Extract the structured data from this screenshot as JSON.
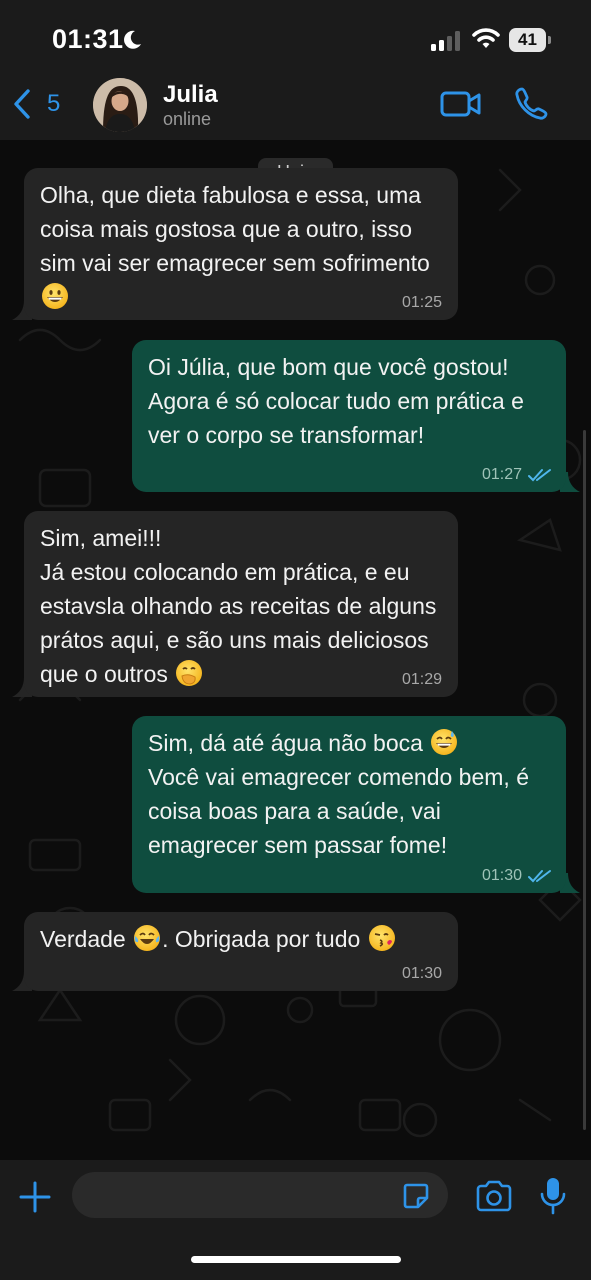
{
  "status_bar": {
    "time": "01:31",
    "battery": "41",
    "icons": [
      "moon-icon",
      "signal-icon",
      "wifi-icon",
      "battery-icon"
    ]
  },
  "header": {
    "back_count": "5",
    "contact_name": "Julia",
    "contact_status": "online",
    "icons": [
      "chevron-left-icon",
      "video-camera-icon",
      "phone-icon"
    ],
    "accent_color": "#2e93e8"
  },
  "chat": {
    "date_label": "Hoje",
    "incoming_color": "#252525",
    "outgoing_color": "#0f4d3f",
    "read_tick_color": "#4fb6ec",
    "messages": [
      {
        "direction": "in",
        "text": "Olha, que dieta fabulosa e essa, uma coisa mais gostosa que a outro, isso sim vai ser emagrecer sem sofrimento",
        "emoji": "grinning-face-icon",
        "time": "01:25"
      },
      {
        "direction": "out",
        "text": "Oi Júlia, que bom que você gostou! Agora é só colocar tudo em prática e ver o corpo se transformar!",
        "time": "01:27",
        "status": "read"
      },
      {
        "direction": "in",
        "text": "Sim, amei!!!\nJá estou colocando em prática, e eu estavsla olhando as receitas de alguns prátos aqui, e são uns mais deliciosos que o outros",
        "emoji": "face-with-hand-over-mouth-icon",
        "time": "01:29"
      },
      {
        "direction": "out",
        "text_before_emoji": "Sim, dá até água não boca",
        "emoji": "grinning-sweat-face-icon",
        "text_after_emoji": "Você vai emagrecer comendo bem, é coisa boas para a saúde, vai emagrecer sem passar fome!",
        "time": "01:30",
        "status": "read"
      },
      {
        "direction": "in",
        "text_before_emoji": "Verdade",
        "emoji": "tears-of-joy-face-icon",
        "text_after_emoji": ". Obrigada por tudo",
        "emoji_2": "kissing-face-icon",
        "time": "01:30"
      }
    ]
  },
  "input_bar": {
    "placeholder": "",
    "icons": [
      "plus-icon",
      "sticker-icon",
      "camera-icon",
      "microphone-icon"
    ]
  }
}
